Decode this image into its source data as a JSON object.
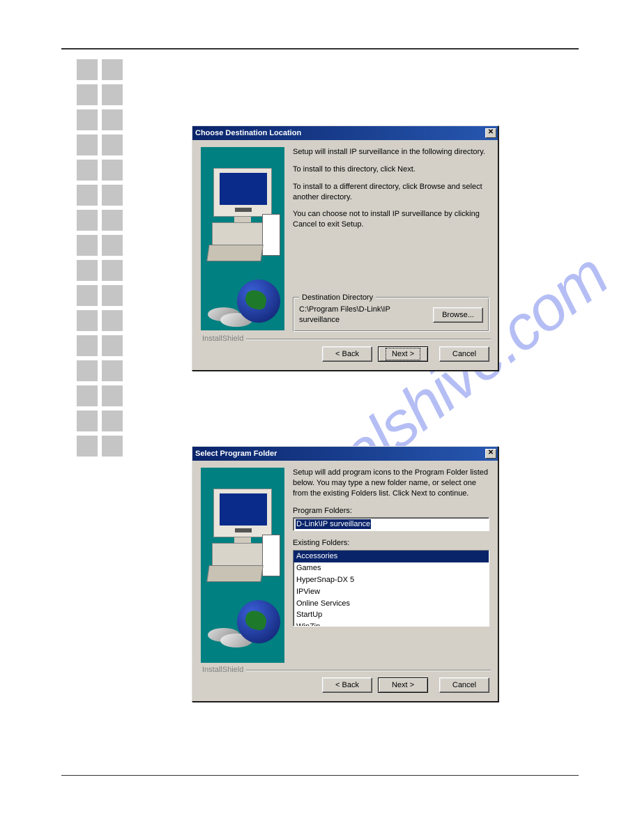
{
  "watermark": "manualshive.com",
  "dialog1": {
    "title": "Choose Destination Location",
    "para1": "Setup will install IP surveillance in the following directory.",
    "para2": "To install to this directory, click Next.",
    "para3": "To install to a different directory, click Browse and select another directory.",
    "para4": "You can choose not to install IP surveillance by clicking Cancel to exit Setup.",
    "group_legend": "Destination Directory",
    "dest_path": "C:\\Program Files\\D-Link\\IP surveillance",
    "browse": "Browse...",
    "footer_label": "InstallShield",
    "back": "< Back",
    "next": "Next >",
    "cancel": "Cancel"
  },
  "dialog2": {
    "title": "Select Program Folder",
    "intro": "Setup will add program icons to the Program Folder listed below. You may type a new folder name, or select one from the existing Folders list.  Click Next to continue.",
    "program_folders_label": "Program Folders:",
    "program_folders_value": "D-Link\\IP surveillance",
    "existing_label": "Existing Folders:",
    "existing": [
      "Accessories",
      "Games",
      "HyperSnap-DX 5",
      "IPView",
      "Online Services",
      "StartUp",
      "WinZip"
    ],
    "footer_label": "InstallShield",
    "back": "< Back",
    "next": "Next >",
    "cancel": "Cancel"
  }
}
